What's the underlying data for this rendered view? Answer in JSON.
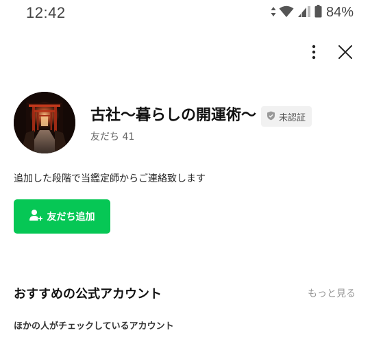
{
  "status_bar": {
    "time": "12:42",
    "battery": "84%",
    "icons": [
      "data-arrows-icon",
      "wifi-icon",
      "signal-icon",
      "battery-icon"
    ]
  },
  "header": {
    "actions": [
      "more-vertical-icon",
      "close-icon"
    ]
  },
  "profile": {
    "name": "古社〜暮らしの開運術〜",
    "badge": "未認証",
    "friends": "友だち 41",
    "description": "追加した段階で当鑑定師からご連絡致します",
    "add_friend_label": "友だち追加"
  },
  "recommended": {
    "title": "おすすめの公式アカウント",
    "see_more": "もっと見る",
    "subtitle": "ほかの人がチェックしているアカウント"
  },
  "colors": {
    "primary_green": "#06c755",
    "badge_bg": "#f1f1f1"
  }
}
